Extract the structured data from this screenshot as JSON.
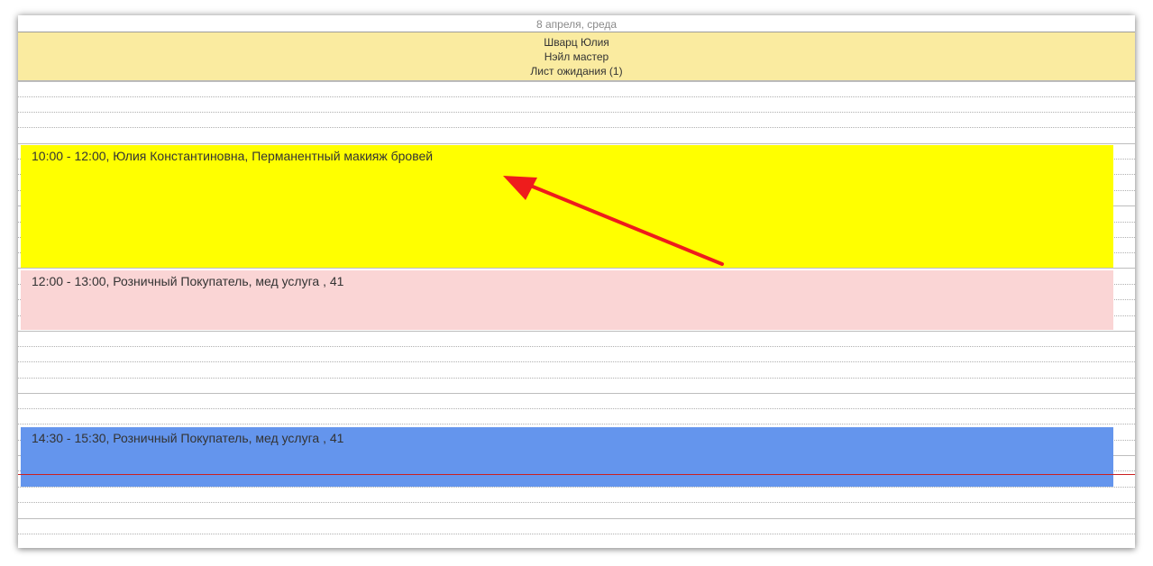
{
  "calendar": {
    "date_label": "8 апреля, среда",
    "master": {
      "name": "Шварц Юлия",
      "role": "Нэйл мастер",
      "waitlist": "Лист ожидания (1)"
    }
  },
  "events": [
    {
      "label": "10:00 - 12:00, Юлия Константиновна, Перманентный макияж бровей",
      "color": "#ffff00"
    },
    {
      "label": "12:00 - 13:00, Розничный Покупатель, мед услуга , 41",
      "color": "#fad5d5"
    },
    {
      "label": "14:30 - 15:30, Розничный Покупатель, мед услуга , 41",
      "color": "#6495ed"
    }
  ],
  "colors": {
    "header_bg": "#faeba0",
    "now_line": "#cc2020",
    "annotation_arrow": "#ee1c1c"
  }
}
